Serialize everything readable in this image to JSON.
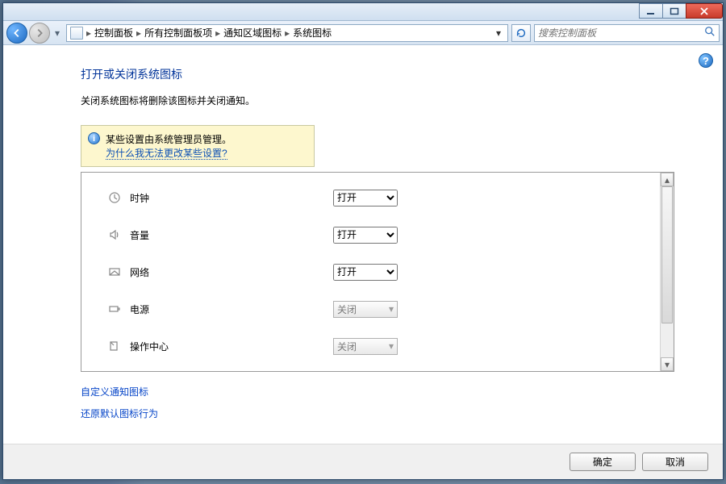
{
  "breadcrumb": [
    "控制面板",
    "所有控制面板项",
    "通知区域图标",
    "系统图标"
  ],
  "search": {
    "placeholder": "搜索控制面板"
  },
  "page": {
    "title": "打开或关闭系统图标",
    "subtitle": "关闭系统图标将删除该图标并关闭通知。"
  },
  "admin": {
    "line1": "某些设置由系统管理员管理。",
    "link": "为什么我无法更改某些设置?"
  },
  "rows": [
    {
      "label": "时钟",
      "value": "打开",
      "enabled": true
    },
    {
      "label": "音量",
      "value": "打开",
      "enabled": true
    },
    {
      "label": "网络",
      "value": "打开",
      "enabled": true
    },
    {
      "label": "电源",
      "value": "关闭",
      "enabled": false
    },
    {
      "label": "操作中心",
      "value": "关闭",
      "enabled": false
    }
  ],
  "select_options": [
    "打开",
    "关闭"
  ],
  "links": {
    "customize": "自定义通知图标",
    "restore": "还原默认图标行为"
  },
  "buttons": {
    "ok": "确定",
    "cancel": "取消"
  }
}
